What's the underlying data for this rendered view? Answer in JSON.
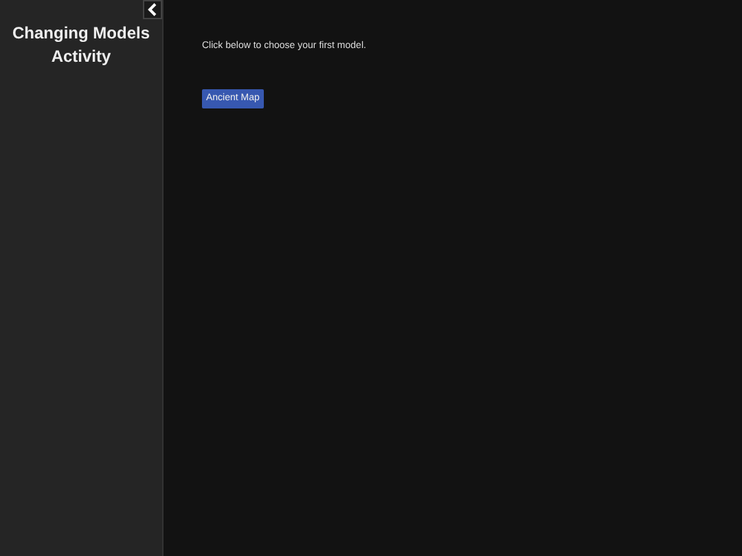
{
  "sidebar": {
    "title": "Changing Models Activity"
  },
  "main": {
    "instruction": "Click below to choose your first model.",
    "buttons": [
      "Ancient Map"
    ]
  }
}
